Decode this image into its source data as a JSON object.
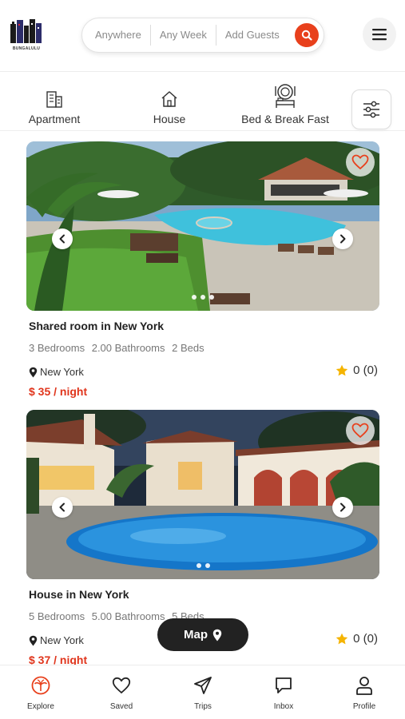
{
  "brand": {
    "logo_text": "BUNGALULU",
    "accent_color": "#e8401c"
  },
  "search": {
    "where": "Anywhere",
    "when": "Any Week",
    "who": "Add Guests",
    "icon": "search-icon"
  },
  "header": {
    "menu_icon": "hamburger-menu-icon"
  },
  "categories": [
    {
      "label": "Apartment",
      "icon": "apartment-building-icon"
    },
    {
      "label": "House",
      "icon": "house-icon"
    },
    {
      "label": "Bed & Break Fast",
      "icon": "bed-breakfast-icon"
    }
  ],
  "filter": {
    "icon": "sliders-icon"
  },
  "listings": [
    {
      "title": "Shared room in New York",
      "bedrooms": "3 Bedrooms",
      "bathrooms": "2.00 Bathrooms",
      "beds": "2 Beds",
      "location": "New York",
      "price": "$ 35 / night",
      "rating": "0 (0)",
      "photo_dots": 3
    },
    {
      "title": "House in New York",
      "bedrooms": "5 Bedrooms",
      "bathrooms": "5.00 Bathrooms",
      "beds": "5 Beds",
      "location": "New York",
      "price": "$ 37 / night",
      "rating": "0 (0)",
      "photo_dots": 2
    }
  ],
  "map_button": {
    "label": "Map",
    "icon": "map-pin-icon"
  },
  "bottom_nav": [
    {
      "label": "Explore",
      "icon": "explore-palm-icon",
      "active": true
    },
    {
      "label": "Saved",
      "icon": "heart-icon"
    },
    {
      "label": "Trips",
      "icon": "paper-plane-icon"
    },
    {
      "label": "Inbox",
      "icon": "chat-bubble-icon"
    },
    {
      "label": "Profile",
      "icon": "person-icon"
    }
  ],
  "colors": {
    "price": "#e0351c",
    "star": "#f5b400",
    "dark_button": "#222222"
  }
}
